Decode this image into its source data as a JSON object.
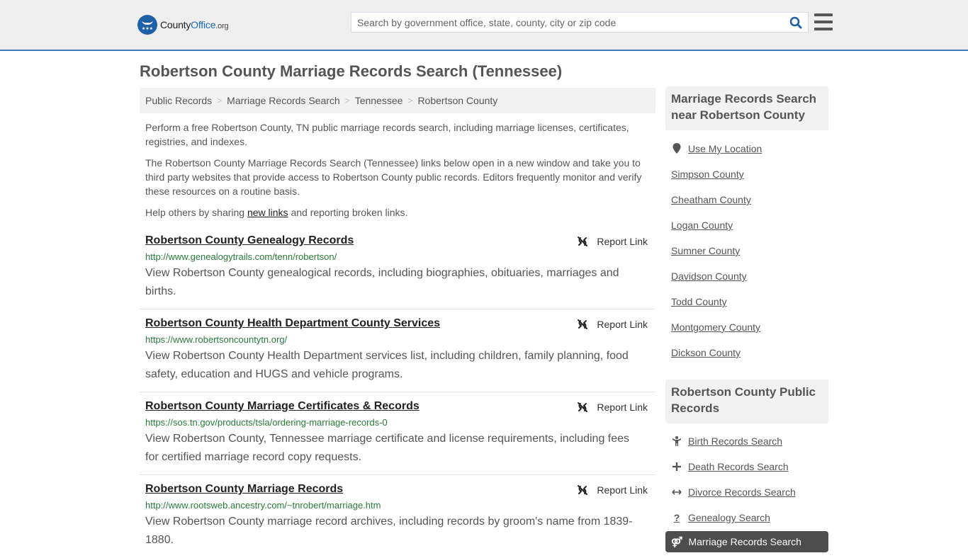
{
  "header": {
    "logo": {
      "brand_main": "County",
      "brand_accent": "Office",
      "brand_suffix": ".org"
    },
    "search": {
      "placeholder": "Search by government office, state, county, city or zip code",
      "value": ""
    },
    "icons": {
      "search": "search-icon",
      "menu": "hamburger-menu-icon"
    }
  },
  "page": {
    "title": "Robertson County Marriage Records Search (Tennessee)",
    "breadcrumb": [
      "Public Records",
      "Marriage Records Search",
      "Tennessee",
      "Robertson County"
    ],
    "intro": {
      "p1": "Perform a free Robertson County, TN public marriage records search, including marriage licenses, certificates, registries, and indexes.",
      "p2": "The Robertson County Marriage Records Search (Tennessee) links below open in a new window and take you to third party websites that provide access to Robertson County public records. Editors frequently monitor and verify these resources on a routine basis.",
      "p3_before": "Help others by sharing ",
      "p3_link": "new links",
      "p3_after": " and reporting broken links."
    }
  },
  "results": [
    {
      "title": "Robertson County Genealogy Records",
      "url": "http://www.genealogytrails.com/tenn/robertson/",
      "description": "View Robertson County genealogical records, including biographies, obituaries, marriages and births.",
      "report_label": "Report Link"
    },
    {
      "title": "Robertson County Health Department County Services",
      "url": "https://www.robertsoncountytn.org/",
      "description": "View Robertson County Health Department services list, including children, family planning, food safety, education and HUGS and vehicle programs.",
      "report_label": "Report Link"
    },
    {
      "title": "Robertson County Marriage Certificates & Records",
      "url": "https://sos.tn.gov/products/tsla/ordering-marriage-records-0",
      "description": "View Robertson County, Tennessee marriage certificate and license requirements, including fees for certified marriage record copy requests.",
      "report_label": "Report Link"
    },
    {
      "title": "Robertson County Marriage Records",
      "url": "http://www.rootsweb.ancestry.com/~tnrobert/marriage.htm",
      "description": "View Robertson County marriage record archives, including records by groom's name from 1839-1880.",
      "report_label": "Report Link"
    }
  ],
  "sidebar": {
    "nearby": {
      "heading": "Marriage Records Search near Robertson County",
      "use_location": "Use My Location",
      "counties": [
        "Simpson County",
        "Cheatham County",
        "Logan County",
        "Sumner County",
        "Davidson County",
        "Todd County",
        "Montgomery County",
        "Dickson County"
      ]
    },
    "public_records": {
      "heading": "Robertson County Public Records",
      "items": [
        {
          "label": "Birth Records Search",
          "icon": "child-icon"
        },
        {
          "label": "Death Records Search",
          "icon": "plus-icon"
        },
        {
          "label": "Divorce Records Search",
          "icon": "arrows-horizontal-icon"
        },
        {
          "label": "Genealogy Search",
          "icon": "question-icon"
        },
        {
          "label": "Marriage Records Search",
          "icon": "marriage-symbol-icon",
          "active": true
        }
      ]
    }
  },
  "colors": {
    "accent_blue": "#3a7cb3",
    "logo_blue": "#1f5fa6",
    "url_green": "#2a7a3b",
    "active_bg": "#4d4d4d"
  }
}
